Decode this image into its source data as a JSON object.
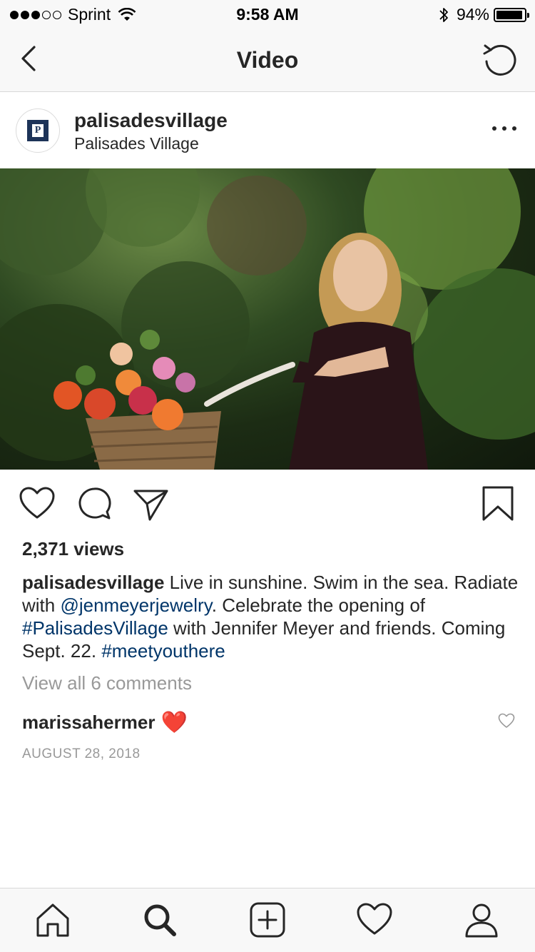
{
  "status_bar": {
    "carrier": "Sprint",
    "time": "9:58 AM",
    "battery_percent": "94%",
    "battery_level": 0.94,
    "signal_bars_filled": 3,
    "signal_bars_total": 5
  },
  "nav": {
    "title": "Video",
    "back_icon": "chevron-left-icon",
    "refresh_icon": "replay-icon"
  },
  "post": {
    "username": "palisadesvillage",
    "location": "Palisades Village",
    "avatar_letter": "P",
    "avatar_color": "#1d3358",
    "views": "2,371 views",
    "caption": {
      "user": "palisadesvillage",
      "part1": " Live in sunshine. Swim in the sea. Radiate with ",
      "mention": "@jenmeyerjewelry",
      "part2": ". Celebrate the opening of ",
      "hashtag1": "#PalisadesVillage",
      "part3": " with Jennifer Meyer and friends. Coming Sept. 22. ",
      "hashtag2": "#meetyouthere"
    },
    "view_all_comments": "View all 6 comments",
    "comment": {
      "user": "marissahermer",
      "text": "❤️"
    },
    "date": "AUGUST 28, 2018"
  },
  "colors": {
    "link": "#003569",
    "muted": "#999999",
    "text": "#262626",
    "heart": "#e0102b"
  },
  "tab_bar": {
    "items": [
      "home-icon",
      "search-icon",
      "add-post-icon",
      "activity-heart-icon",
      "profile-icon"
    ]
  }
}
